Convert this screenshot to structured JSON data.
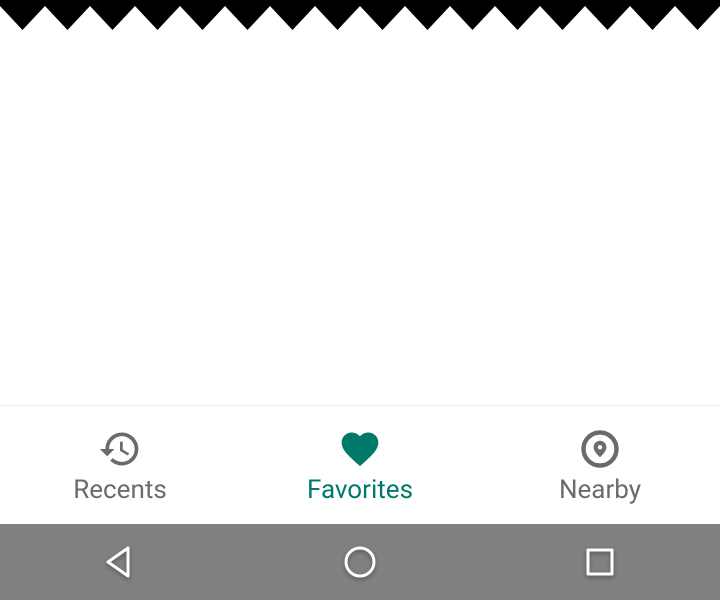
{
  "bottom_nav": {
    "items": [
      {
        "label": "Recents",
        "icon": "history-icon",
        "active": false
      },
      {
        "label": "Favorites",
        "icon": "heart-icon",
        "active": true
      },
      {
        "label": "Nearby",
        "icon": "place-icon",
        "active": false
      }
    ]
  },
  "colors": {
    "accent": "#00796b",
    "inactive": "#6b6b6b",
    "sys_nav_bg": "#808080"
  }
}
